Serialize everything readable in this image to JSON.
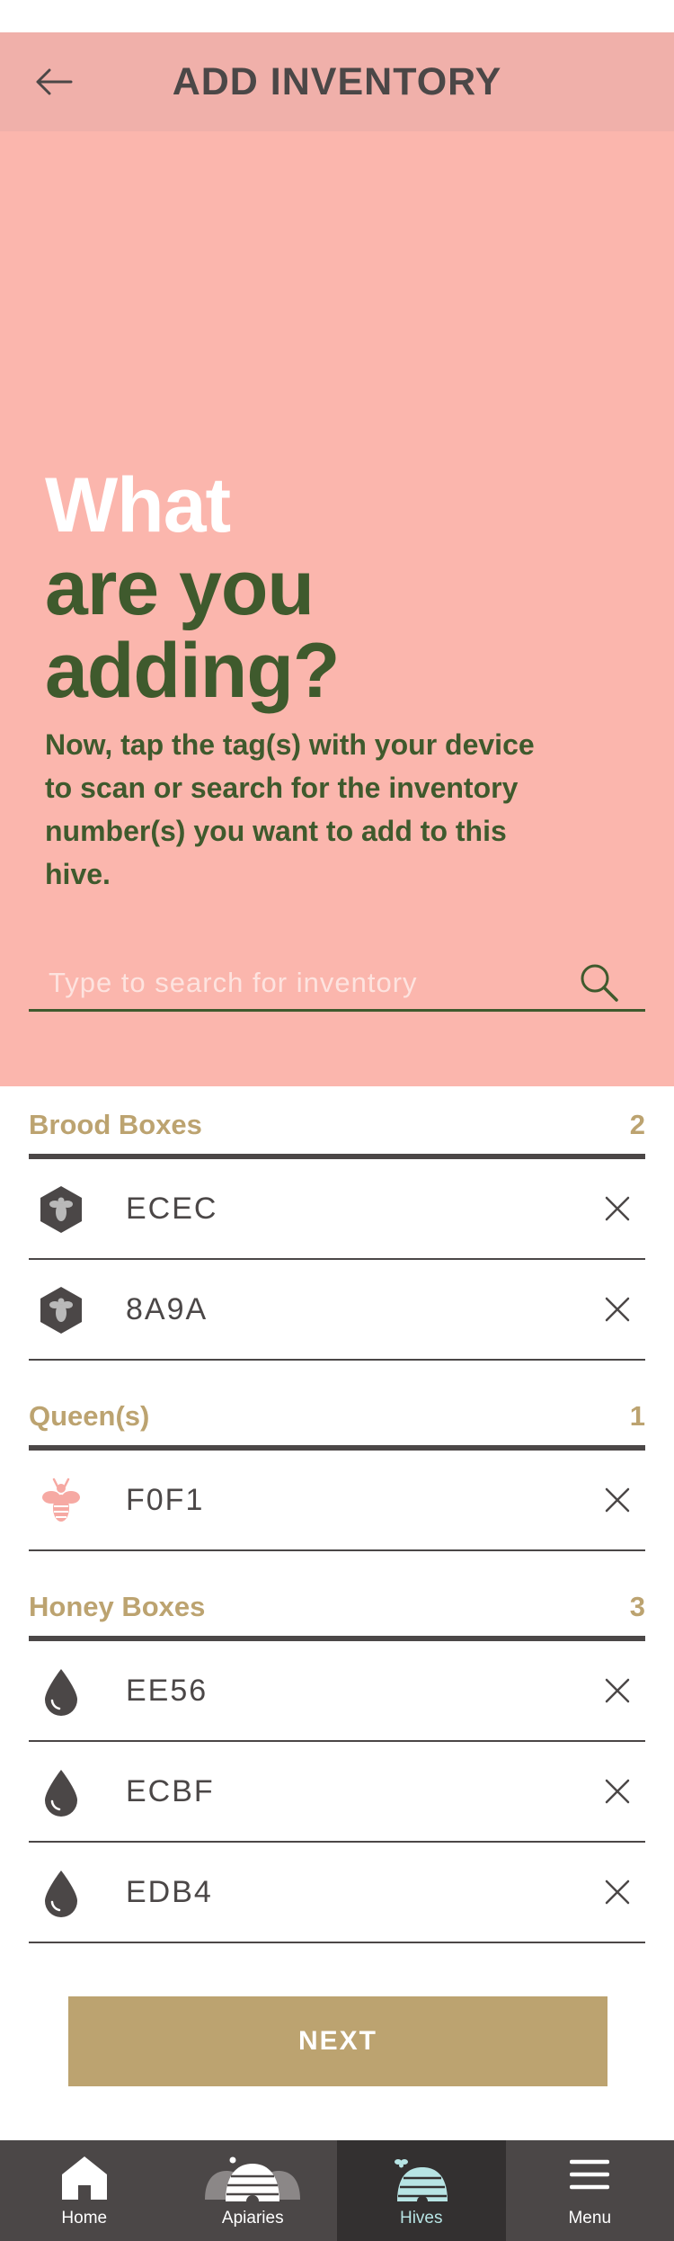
{
  "header": {
    "title": "ADD INVENTORY"
  },
  "hero": {
    "line1": "What",
    "line2": "are you adding?",
    "subtitle": "Now, tap the tag(s) with your device to scan or search for the inventory number(s) you want to add to this hive."
  },
  "search": {
    "placeholder": "Type to search for inventory",
    "value": ""
  },
  "sections": [
    {
      "title": "Brood Boxes",
      "count": "2",
      "icon": "bee-hexagon-icon",
      "items": [
        {
          "code": "ECEC"
        },
        {
          "code": "8A9A"
        }
      ]
    },
    {
      "title": "Queen(s)",
      "count": "1",
      "icon": "queen-bee-icon",
      "items": [
        {
          "code": "F0F1"
        }
      ]
    },
    {
      "title": "Honey Boxes",
      "count": "3",
      "icon": "honey-drop-icon",
      "items": [
        {
          "code": "EE56"
        },
        {
          "code": "ECBF"
        },
        {
          "code": "EDB4"
        }
      ]
    }
  ],
  "next_button": {
    "label": "NEXT"
  },
  "bottom_nav": [
    {
      "label": "Home",
      "icon": "home-icon",
      "active": false
    },
    {
      "label": "Apiaries",
      "icon": "apiaries-icon",
      "active": false
    },
    {
      "label": "Hives",
      "icon": "hive-icon",
      "active": true
    },
    {
      "label": "Menu",
      "icon": "menu-icon",
      "active": false
    }
  ],
  "colors": {
    "appbar": "#f0b0aa",
    "hero": "#fbb6ad",
    "dark_green": "#3f5a2d",
    "gold": "#bca370",
    "charcoal": "#4b4747",
    "active_nav": "#333030",
    "hive_blue": "#b7e4e4",
    "queen_pink": "#f6a9a3"
  }
}
